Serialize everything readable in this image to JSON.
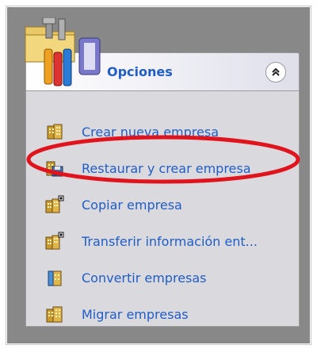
{
  "panel": {
    "title": "Opciones",
    "collapse_icon": "double-chevron-up-icon",
    "header_icon": "tools-folder-icon"
  },
  "items": [
    {
      "label": "Crear nueva empresa",
      "icon": "building-icon"
    },
    {
      "label": "Restaurar y crear empresa",
      "icon": "building-disk-icon"
    },
    {
      "label": "Copiar empresa",
      "icon": "building-copy-icon"
    },
    {
      "label": "Transferir información ent...",
      "icon": "building-transfer-icon"
    },
    {
      "label": "Convertir empresas",
      "icon": "building-convert-icon"
    },
    {
      "label": "Migrar empresas",
      "icon": "building-migrate-icon"
    }
  ],
  "annotation": {
    "color": "#e0141c",
    "target_item": "Restaurar y crear empresa"
  },
  "colors": {
    "link": "#215dc6",
    "background": "#888888",
    "panel_body": "#d9d9de"
  }
}
